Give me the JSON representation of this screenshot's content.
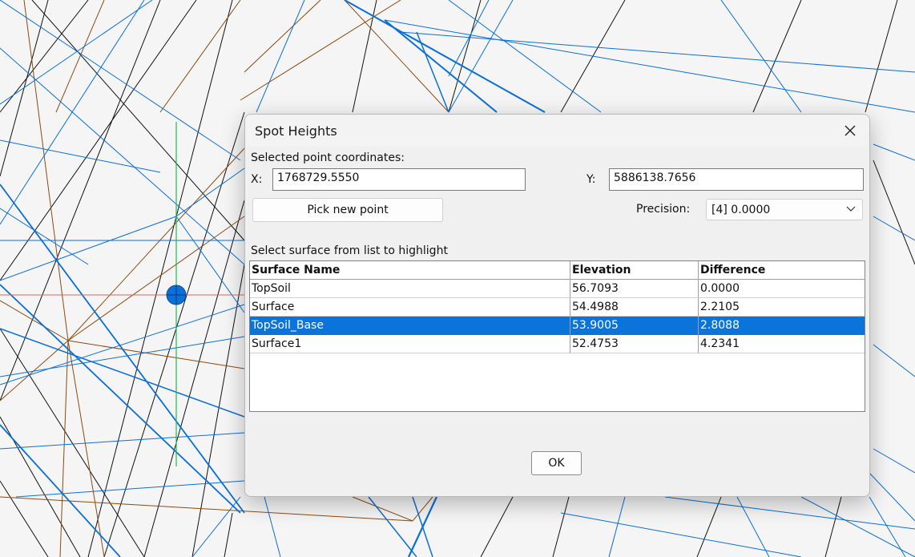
{
  "dialog": {
    "title": "Spot Heights",
    "coords_label": "Selected point coordinates:",
    "x_label": "X:",
    "x_value": "1768729.5550",
    "y_label": "Y:",
    "y_value": "5886138.7656",
    "pick_button": "Pick new point",
    "precision_label": "Precision:",
    "precision_value": "[4] 0.0000",
    "list_label": "Select surface from list to highlight",
    "columns": [
      "Surface Name",
      "Elevation",
      "Difference"
    ],
    "rows": [
      {
        "name": "TopSoil",
        "elevation": "56.7093",
        "difference": "0.0000",
        "selected": false
      },
      {
        "name": "Surface",
        "elevation": "54.4988",
        "difference": "2.2105",
        "selected": false
      },
      {
        "name": "TopSoil_Base",
        "elevation": "53.9005",
        "difference": "2.8088",
        "selected": true
      },
      {
        "name": "Surface1",
        "elevation": "52.4753",
        "difference": "4.2341",
        "selected": false
      }
    ],
    "ok_button": "OK",
    "close_icon": "close-icon",
    "dropdown_icon": "chevron-down-icon"
  },
  "colors": {
    "tin_lines": "#0a6fd6",
    "breaklines": "#8b4a10",
    "contours": "#111111",
    "crosshair_vertical": "#1bbf4a",
    "crosshair_horizontal": "#e0645a",
    "selection": "#0a74da"
  }
}
